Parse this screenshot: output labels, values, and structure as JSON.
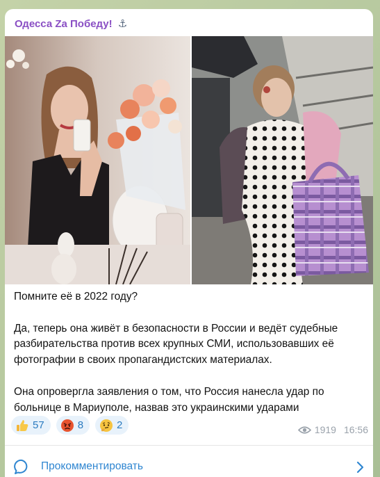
{
  "channel": {
    "title": "Одесса Za Победу!",
    "title_icon": "anchor-icon",
    "title_icon_glyph": "⚓"
  },
  "post": {
    "paragraphs": [
      "Помните её в 2022 году?",
      "Да, теперь она живёт в безопасности в России и ведёт судебные разбирательства против всех крупных СМИ, использовавших её фотографии в своих пропагандистских материалах.",
      "Она опровергла заявления о том, что Россия нанесла удар по больнице в Мариуполе, назвав это украинскими ударами"
    ],
    "photos": [
      "mirror-selfie-photo",
      "hospital-evacuation-photo"
    ]
  },
  "reactions": [
    {
      "icon": "thumbs-up-icon",
      "count": "57"
    },
    {
      "icon": "angry-face-icon",
      "count": "8"
    },
    {
      "icon": "thinking-face-icon",
      "count": "2"
    }
  ],
  "meta": {
    "views": "1919",
    "time": "16:56",
    "views_icon": "eye-icon"
  },
  "comments": {
    "label": "Прокомментировать",
    "icon": "comment-bubble-icon",
    "arrow_icon": "chevron-right-icon"
  },
  "colors": {
    "channel_name": "#8a4fc4",
    "accent": "#2f86d1",
    "reaction_bg": "#e8f2fb",
    "meta_gray": "#9aa2ab",
    "chat_background": "#b9c8a4"
  }
}
